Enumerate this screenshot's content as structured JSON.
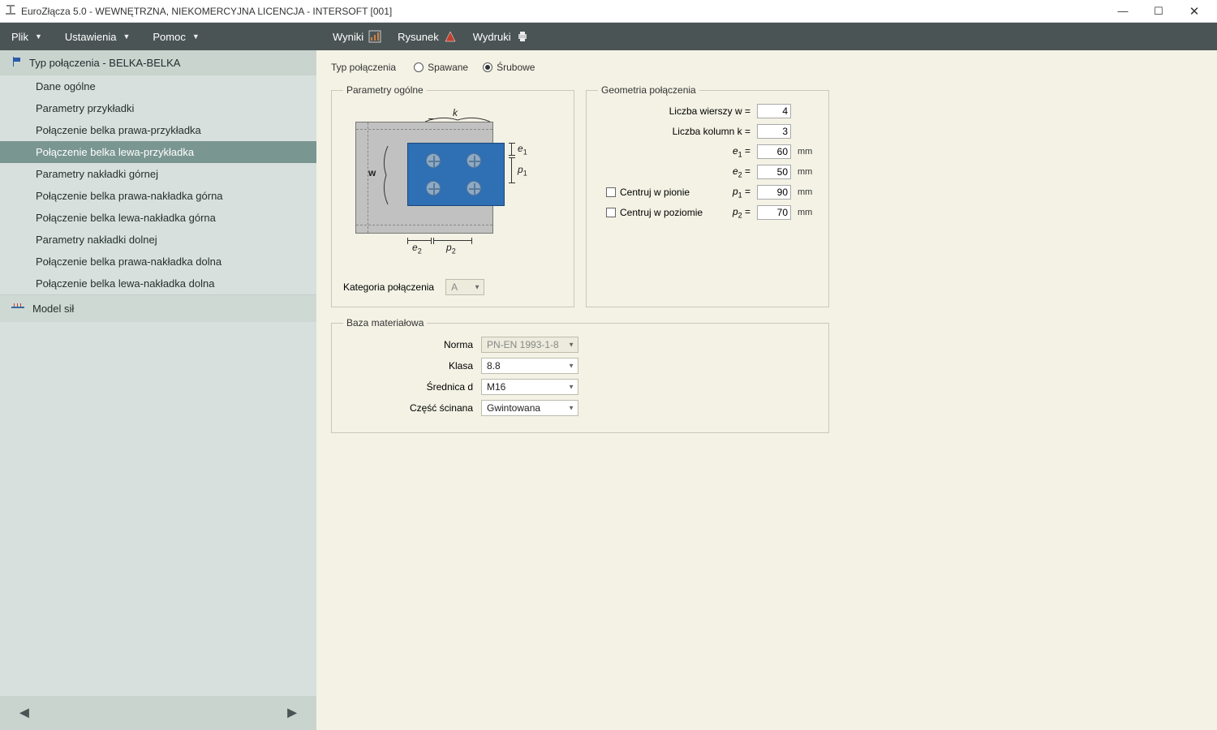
{
  "window": {
    "title": "EuroZłącza 5.0 - WEWNĘTRZNA, NIEKOMERCYJNA LICENCJA - INTERSOFT [001]"
  },
  "menu": {
    "plik": "Plik",
    "ustawienia": "Ustawienia",
    "pomoc": "Pomoc"
  },
  "toolbar": {
    "wyniki": "Wyniki",
    "rysunek": "Rysunek",
    "wydruki": "Wydruki"
  },
  "sidebar": {
    "header": "Typ połączenia - BELKA-BELKA",
    "items": [
      "Dane ogólne",
      "Parametry przykładki",
      "Połączenie belka prawa-przykładka",
      "Połączenie belka lewa-przykładka",
      "Parametry nakładki górnej",
      "Połączenie belka prawa-nakładka górna",
      "Połączenie belka lewa-nakładka górna",
      "Parametry nakładki dolnej",
      "Połączenie belka prawa-nakładka dolna",
      "Połączenie belka lewa-nakładka dolna"
    ],
    "selected_index": 3,
    "model_sil": "Model sił"
  },
  "content": {
    "type_label": "Typ połączenia",
    "radio_spawane": "Spawane",
    "radio_srubowe": "Śrubowe",
    "radio_selected": "srubowe",
    "fs_params_title": "Parametry ogólne",
    "fs_geom_title": "Geometria połączenia",
    "fs_material_title": "Baza materiałowa",
    "diagram": {
      "k": "k",
      "w": "w",
      "e1": "e",
      "e1s": "1",
      "e2": "e",
      "e2s": "2",
      "p1": "p",
      "p1s": "1",
      "p2": "p",
      "p2s": "2"
    },
    "category_label": "Kategoria połączenia",
    "category_value": "A",
    "geom": {
      "rows_label": "Liczba wierszy w =",
      "rows_value": "4",
      "cols_label": "Liczba kolumn k =",
      "cols_value": "3",
      "e1_sym": "e",
      "e1_sub": "1",
      "e1_eq": "=",
      "e1_val": "60",
      "e1_unit": "mm",
      "e2_sym": "e",
      "e2_sub": "2",
      "e2_eq": "=",
      "e2_val": "50",
      "e2_unit": "mm",
      "p1_sym": "p",
      "p1_sub": "1",
      "p1_eq": "=",
      "p1_val": "90",
      "p1_unit": "mm",
      "p2_sym": "p",
      "p2_sub": "2",
      "p2_eq": "=",
      "p2_val": "70",
      "p2_unit": "mm",
      "chk_pion": "Centruj w pionie",
      "chk_poziom": "Centruj w poziomie"
    },
    "material": {
      "norma_label": "Norma",
      "norma_value": "PN-EN 1993-1-8",
      "klasa_label": "Klasa",
      "klasa_value": "8.8",
      "srednica_label": "Średnica d",
      "srednica_value": "M16",
      "czesc_label": "Część ścinana",
      "czesc_value": "Gwintowana"
    }
  }
}
